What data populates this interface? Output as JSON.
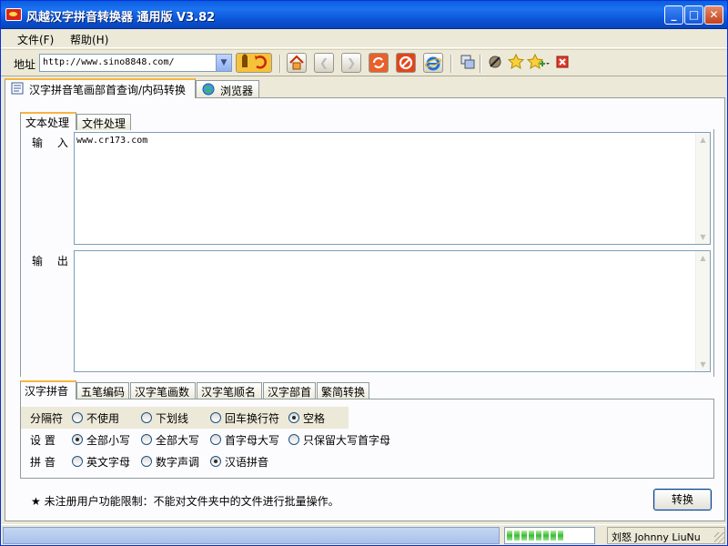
{
  "window": {
    "title": "风越汉字拼音转换器 通用版 V3.82",
    "controls": {
      "minimize": "_",
      "maximize": "□",
      "close": "✕"
    }
  },
  "menu": {
    "items": [
      "文件(F)",
      "帮助(H)"
    ]
  },
  "toolbar": {
    "address_label": "地址",
    "address_value": "http://www.sino8848.com/",
    "buttons": [
      "go-icon",
      "home-icon",
      "back-icon",
      "forward-icon",
      "refresh-icon",
      "stop-icon",
      "ie-icon",
      "window-icon",
      "settings-icon",
      "favorite-icon",
      "add-favorite-icon",
      "close-icon"
    ]
  },
  "main_tabs": [
    {
      "label": "汉字拼音笔画部首查询/内码转换",
      "active": true
    },
    {
      "label": "浏览器",
      "active": false
    }
  ],
  "sub_tabs": [
    {
      "label": "文本处理",
      "active": true
    },
    {
      "label": "文件处理",
      "active": false
    }
  ],
  "input": {
    "label": "输 入",
    "value": "www.cr173.com"
  },
  "output": {
    "label": "输 出",
    "value": ""
  },
  "bottom_tabs": [
    {
      "label": "汉字拼音",
      "active": true
    },
    {
      "label": "五笔编码",
      "active": false
    },
    {
      "label": "汉字笔画数",
      "active": false
    },
    {
      "label": "汉字笔顺名",
      "active": false
    },
    {
      "label": "汉字部首",
      "active": false
    },
    {
      "label": "繁简转换",
      "active": false
    }
  ],
  "options": {
    "separator": {
      "label": "分隔符",
      "choices": [
        "不使用",
        "下划线",
        "回车换行符",
        "空格"
      ],
      "selected": "空格"
    },
    "setting": {
      "label": "设 置",
      "choices": [
        "全部小写",
        "全部大写",
        "首字母大写",
        "只保留大写首字母"
      ],
      "selected": "全部小写"
    },
    "pinyin": {
      "label": "拼 音",
      "choices": [
        "英文字母",
        "数字声调",
        "汉语拼音"
      ],
      "selected": "汉语拼音"
    }
  },
  "note": "★ 未注册用户功能限制：不能对文件夹中的文件进行批量操作。",
  "convert_button": "转换",
  "status": {
    "left": "",
    "progress_fraction": 1.0,
    "right": "刘怒 Johnny LiuNu"
  }
}
